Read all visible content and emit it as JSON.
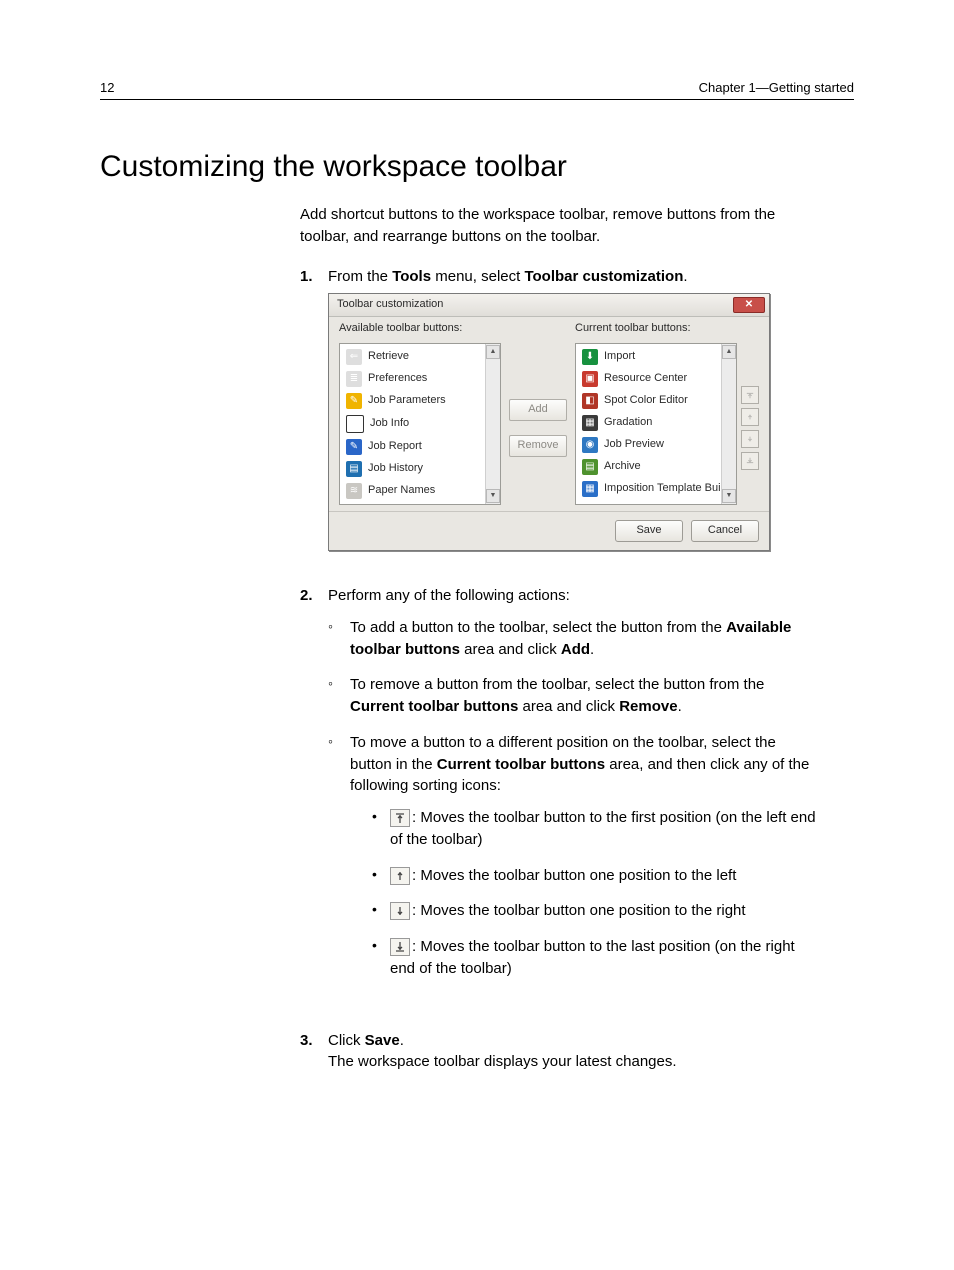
{
  "header": {
    "page_number": "12",
    "chapter": "Chapter 1—Getting started"
  },
  "title": "Customizing the workspace toolbar",
  "intro": "Add shortcut buttons to the workspace toolbar, remove buttons from the toolbar, and rearrange buttons on the toolbar.",
  "steps": {
    "s1": {
      "num": "1.",
      "pre": "From the ",
      "b1": "Tools",
      "mid": " menu, select ",
      "b2": "Toolbar customization",
      "post": "."
    },
    "s2": {
      "num": "2.",
      "text": "Perform any of the following actions:",
      "a": {
        "pre": "To add a button to the toolbar, select the button from the ",
        "b1": "Available toolbar buttons",
        "mid": " area and click ",
        "b2": "Add",
        "post": "."
      },
      "b": {
        "pre": "To remove a button from the toolbar, select the button from the ",
        "b1": "Current toolbar buttons",
        "mid": " area and click ",
        "b2": "Remove",
        "post": "."
      },
      "c": {
        "pre": "To move a button to a different position on the toolbar, select the button in the ",
        "b1": "Current toolbar buttons",
        "post": " area, and then click any of the following sorting icons:"
      },
      "icons": {
        "first": ": Moves the toolbar button to the first position (on the left end of the toolbar)",
        "left": ": Moves the toolbar button one position to the left",
        "right": ": Moves the toolbar button one position to the right",
        "last": ": Moves the toolbar button to the last position (on the right end of the toolbar)"
      }
    },
    "s3": {
      "num": "3.",
      "pre": "Click ",
      "b1": "Save",
      "post": ".",
      "result": "The workspace toolbar displays your latest changes."
    }
  },
  "dialog": {
    "title": "Toolbar customization",
    "available_label": "Available toolbar buttons:",
    "current_label": "Current toolbar buttons:",
    "add": "Add",
    "remove": "Remove",
    "save": "Save",
    "cancel": "Cancel",
    "available": [
      {
        "label": "Retrieve",
        "cls": "ic-retrieve",
        "g": "⇐"
      },
      {
        "label": "Preferences",
        "cls": "ic-prefs",
        "g": "≣"
      },
      {
        "label": "Job Parameters",
        "cls": "ic-jobparam",
        "g": "✎"
      },
      {
        "label": "Job Info",
        "cls": "ic-jobinfo",
        "g": "i"
      },
      {
        "label": "Job Report",
        "cls": "ic-jobreport",
        "g": "✎"
      },
      {
        "label": "Job History",
        "cls": "ic-jobhist",
        "g": "▤"
      },
      {
        "label": "Paper Names",
        "cls": "ic-paper",
        "g": "≋"
      }
    ],
    "current": [
      {
        "label": "Import",
        "cls": "ic-import",
        "g": "⬇"
      },
      {
        "label": "Resource Center",
        "cls": "ic-resource",
        "g": "▣"
      },
      {
        "label": "Spot Color Editor",
        "cls": "ic-spot",
        "g": "◧"
      },
      {
        "label": "Gradation",
        "cls": "ic-grad",
        "g": "▦"
      },
      {
        "label": "Job Preview",
        "cls": "ic-preview",
        "g": "◉"
      },
      {
        "label": "Archive",
        "cls": "ic-archive",
        "g": "▤"
      },
      {
        "label": "Imposition Template Builder",
        "cls": "ic-imposition",
        "g": "▦"
      }
    ]
  }
}
